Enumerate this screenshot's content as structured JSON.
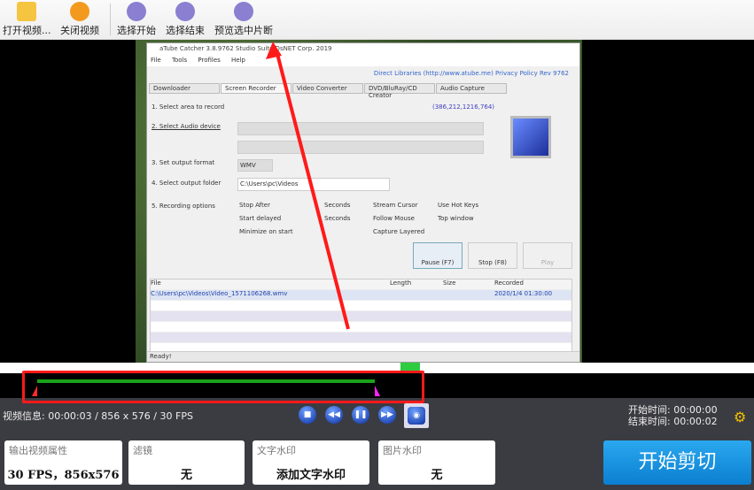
{
  "toolbar": {
    "open": "打开视频...",
    "close": "关闭视频",
    "select_start": "选择开始",
    "select_end": "选择结束",
    "preview": "预览选中片断"
  },
  "inner_app": {
    "title": "aTube Catcher 3.8.9762   Studio Suite   DsNET Corp. 2019",
    "menu": "File Tools Profiles Help",
    "links": "Direct Libraries (http://www.atube.me)   Privacy Policy   Rev 9762",
    "tabs": [
      "Downloader",
      "Screen Recorder",
      "Video Converter",
      "DVD/BluRay/CD Creator",
      "Audio Capture"
    ],
    "step1": "1. Select area to record",
    "coords": "(386,212,1216,764)",
    "step2": "2. Select Audio device",
    "step3": "3. Set output format",
    "format": "WMV",
    "step4": "4. Select output folder",
    "folder": "C:\\Users\\pc\\Videos",
    "step5": "5. Recording options",
    "opts": [
      "Stop After",
      "Start delayed",
      "Minimize on start",
      "Seconds",
      "Seconds",
      "Stream Cursor",
      "Follow Mouse",
      "Capture Layered",
      "Use Hot Keys",
      "Top window"
    ],
    "buttons": [
      "Pause (F7)",
      "Stop (F8)",
      "Play"
    ],
    "cols": [
      "File",
      "Length",
      "Size",
      "Recorded"
    ],
    "row": {
      "file": "C:\\Users\\pc\\Videos\\Video_1571106268.wmv",
      "recorded": "2020/1/4 01:30:00"
    },
    "status": "Ready!"
  },
  "info": {
    "video_info": "视频信息: 00:00:03 / 856 x 576 / 30 FPS",
    "start_time": "开始时间: 00:00:00",
    "end_time": "结束时间: 00:00:02"
  },
  "panels": [
    {
      "label": "输出视频属性",
      "value": "30 FPS，856x576"
    },
    {
      "label": "滤镜",
      "value": "无"
    },
    {
      "label": "文字水印",
      "value": "添加文字水印"
    },
    {
      "label": "图片水印",
      "value": "无"
    }
  ],
  "start_cut": "开始剪切",
  "timeline": {
    "selection_end_fraction": 0.95
  }
}
